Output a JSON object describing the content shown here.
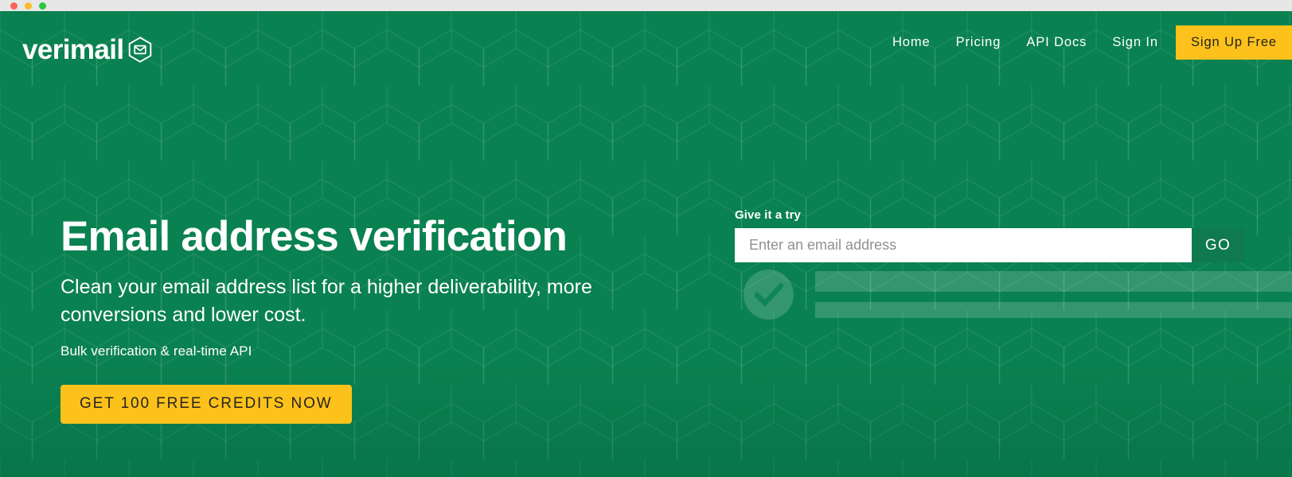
{
  "window": {
    "titlebar_buttons": [
      "close",
      "minimize",
      "zoom"
    ],
    "titlebar_color": "#e7e7e7"
  },
  "theme": {
    "brand_green": "#0a8150",
    "brand_green_dark": "#107a4f",
    "accent_yellow": "#fcc21b",
    "text_on_accent": "#262320",
    "text_white": "#ffffff"
  },
  "header": {
    "logo_text": "verimail",
    "logo_icon": "hexagon-envelope-icon",
    "nav": [
      {
        "label": "Home",
        "kind": "link"
      },
      {
        "label": "Pricing",
        "kind": "link"
      },
      {
        "label": "API Docs",
        "kind": "link"
      },
      {
        "label": "Sign In",
        "kind": "link"
      },
      {
        "label": "Sign Up Free",
        "kind": "button"
      }
    ]
  },
  "hero": {
    "headline": "Email address verification",
    "subheadline": "Clean your email address list for a higher deliverability, more conversions and lower cost.",
    "tagline": "Bulk verification & real-time API",
    "cta_label": "GET 100 FREE CREDITS NOW"
  },
  "try_widget": {
    "label": "Give it a try",
    "input_placeholder": "Enter an email address",
    "input_value": "",
    "submit_label": "GO",
    "result_state": "placeholder",
    "result_icon": "check-circle-icon",
    "skeleton_bars": 2
  }
}
